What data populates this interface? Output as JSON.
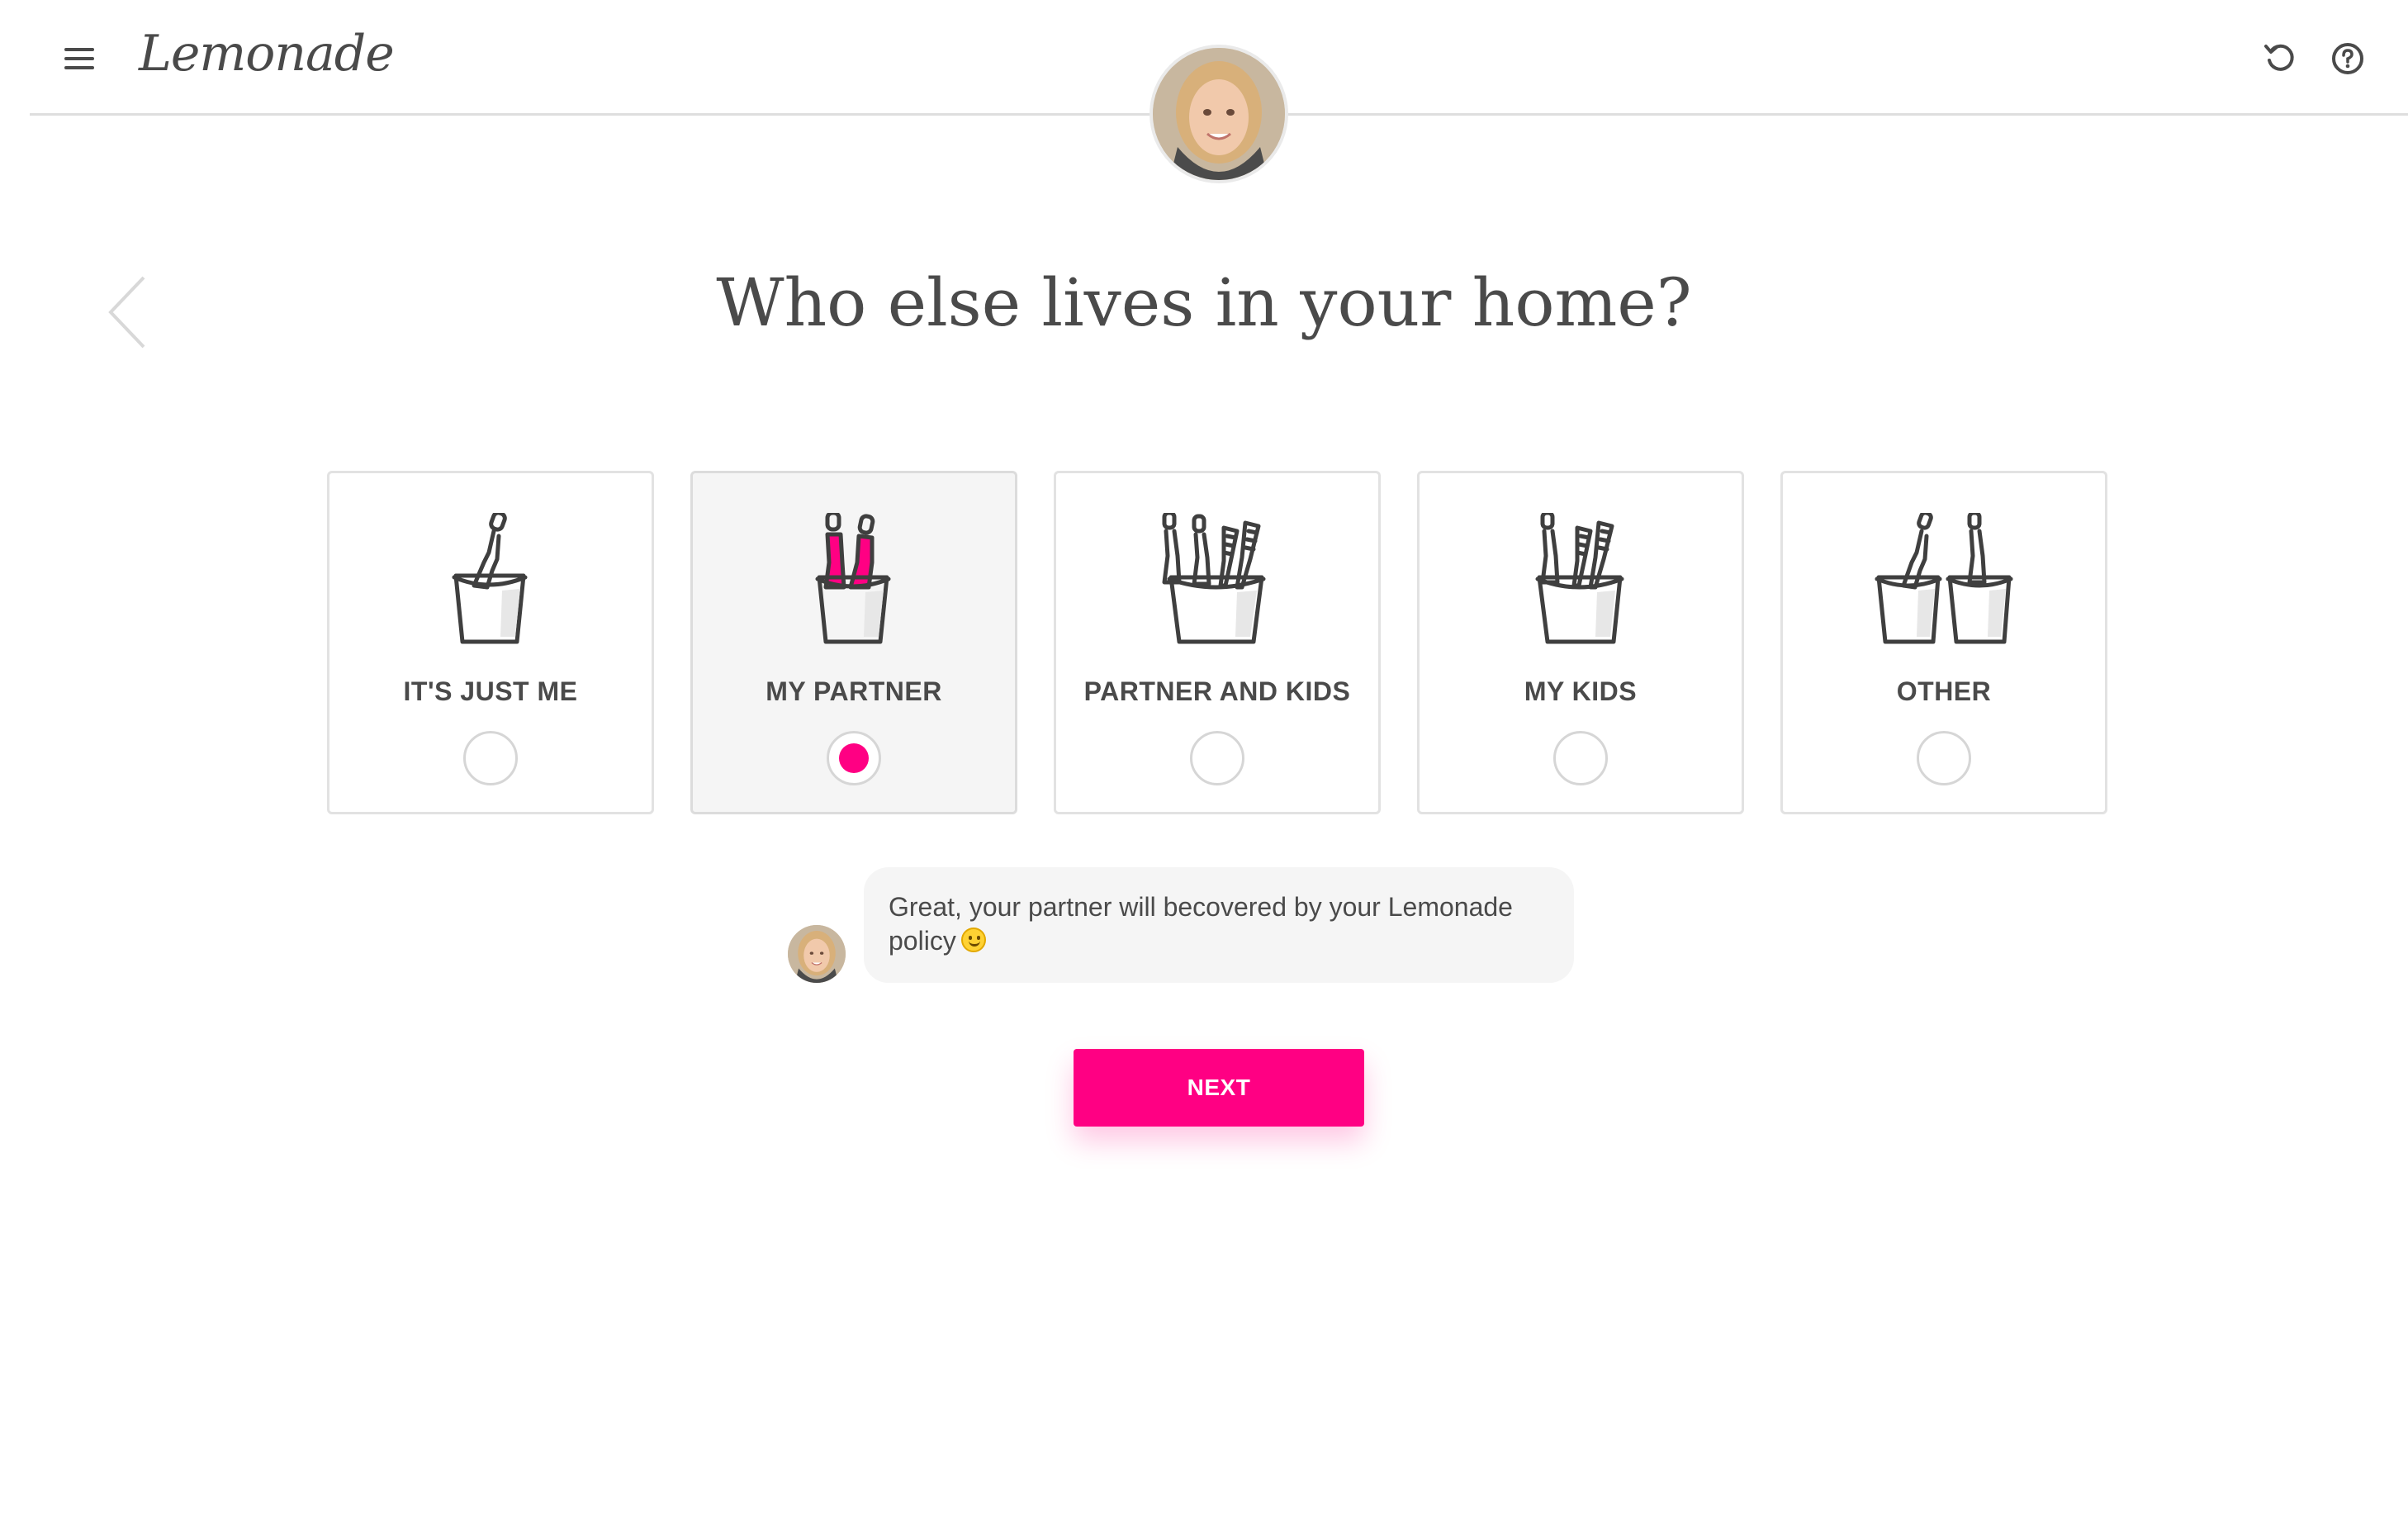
{
  "header": {
    "logo": "Lemonade",
    "menu_icon": "hamburger-menu-icon",
    "undo_icon": "undo-icon",
    "help_icon": "help-icon"
  },
  "question": {
    "title": "Who else lives in your home?"
  },
  "options": [
    {
      "label": "IT'S JUST ME",
      "icon": "single-toothbrush-cup-icon",
      "selected": false
    },
    {
      "label": "MY PARTNER",
      "icon": "two-toothbrushes-cup-icon",
      "selected": true
    },
    {
      "label": "PARTNER AND KIDS",
      "icon": "family-toothbrushes-cup-icon",
      "selected": false
    },
    {
      "label": "MY KIDS",
      "icon": "kids-toothbrushes-cup-icon",
      "selected": false
    },
    {
      "label": "OTHER",
      "icon": "two-cups-toothbrushes-icon",
      "selected": false
    }
  ],
  "chat": {
    "message": "Great, your partner will becovered by your Lemonade policy",
    "emoji": "smiley-emoji-icon"
  },
  "next_button": {
    "label": "NEXT"
  },
  "colors": {
    "accent": "#ff0083",
    "text": "#4a4a4a",
    "border": "#e2e2e2",
    "selected_bg": "#f5f5f5"
  }
}
